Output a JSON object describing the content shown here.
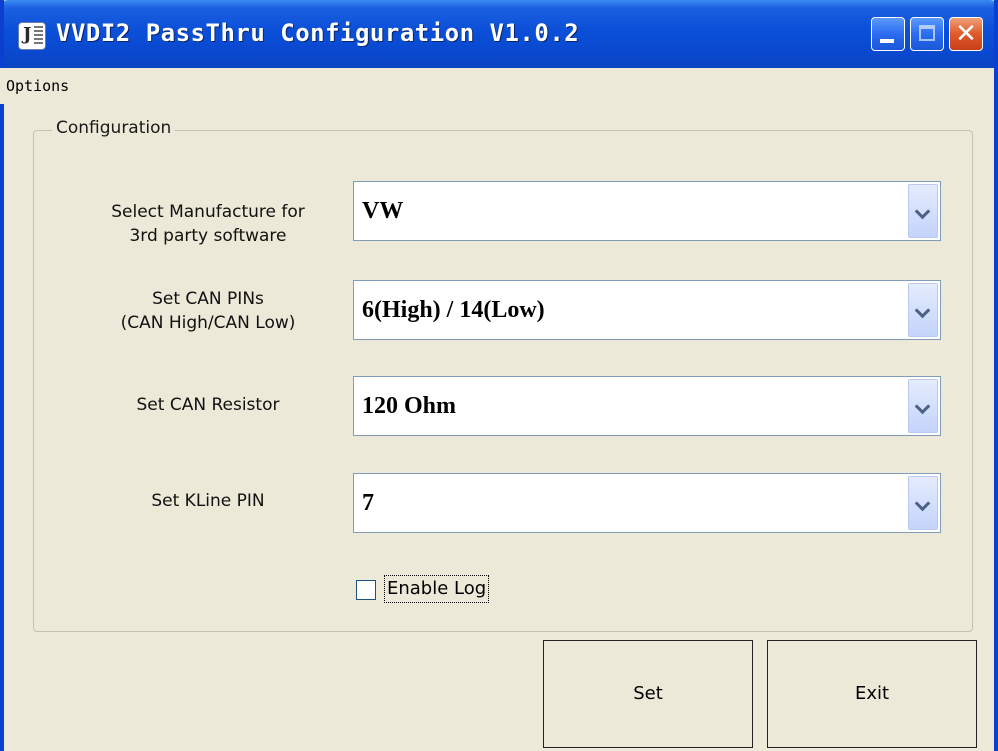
{
  "window": {
    "title": "VVDI2 PassThru Configuration V1.0.2",
    "title_icon": "app-icon",
    "buttons": [
      "minimize-icon",
      "maximize-icon",
      "close-icon"
    ]
  },
  "menu": {
    "items": [
      "Options"
    ]
  },
  "config": {
    "group_title": "Configuration",
    "manufacture": {
      "label": "Select Manufacture for\n3rd party software",
      "value": "VW"
    },
    "can_pins": {
      "label": "Set CAN PINs\n(CAN High/CAN Low)",
      "value": "6(High) / 14(Low)"
    },
    "can_resistor": {
      "label": "Set CAN Resistor",
      "value": "120 Ohm"
    },
    "kline_pin": {
      "label": "Set KLine PIN",
      "value": "7"
    },
    "enable_log": {
      "label": "Enable Log",
      "checked": false
    }
  },
  "actions": {
    "set_label": "Set",
    "exit_label": "Exit"
  },
  "colors": {
    "titlebar": "#0b4fd8",
    "face": "#ece9d8",
    "close_button": "#e05a2a"
  }
}
